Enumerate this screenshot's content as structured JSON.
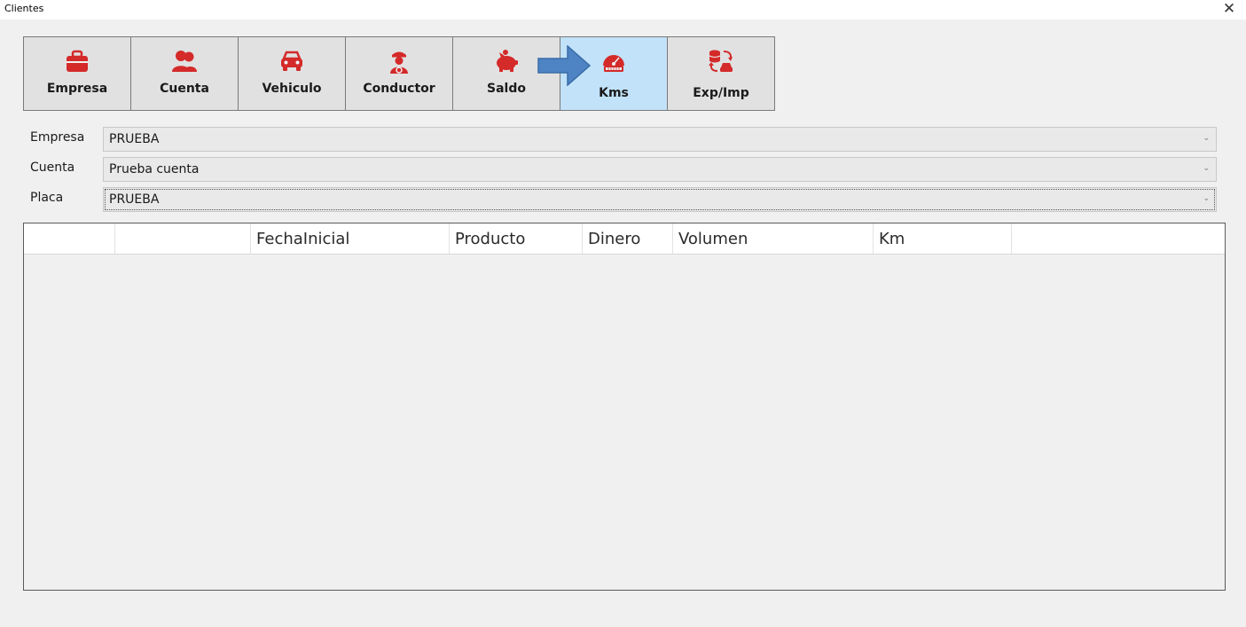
{
  "window": {
    "title": "Clientes",
    "close_symbol": "✕"
  },
  "toolbar": {
    "buttons": [
      {
        "label": "Empresa",
        "icon": "briefcase-icon"
      },
      {
        "label": "Cuenta",
        "icon": "users-icon"
      },
      {
        "label": "Vehiculo",
        "icon": "car-icon"
      },
      {
        "label": "Conductor",
        "icon": "driver-icon"
      },
      {
        "label": "Saldo",
        "icon": "piggy-bank-icon"
      },
      {
        "label": "Kms",
        "icon": "odometer-icon",
        "active": true
      },
      {
        "label": "Exp/Imp",
        "icon": "export-import-icon"
      }
    ]
  },
  "form": {
    "empresa": {
      "label": "Empresa",
      "value": "PRUEBA"
    },
    "cuenta": {
      "label": "Cuenta",
      "value": "Prueba cuenta"
    },
    "placa": {
      "label": "Placa",
      "value": "PRUEBA"
    }
  },
  "grid": {
    "columns": [
      "",
      "",
      "FechaInicial",
      "Producto",
      "Dinero",
      "Volumen",
      "Km",
      ""
    ],
    "rows": []
  },
  "colors": {
    "accent_red": "#d42a2a",
    "active_bg": "#c1e2f8",
    "arrow_blue": "#4f84c4"
  }
}
